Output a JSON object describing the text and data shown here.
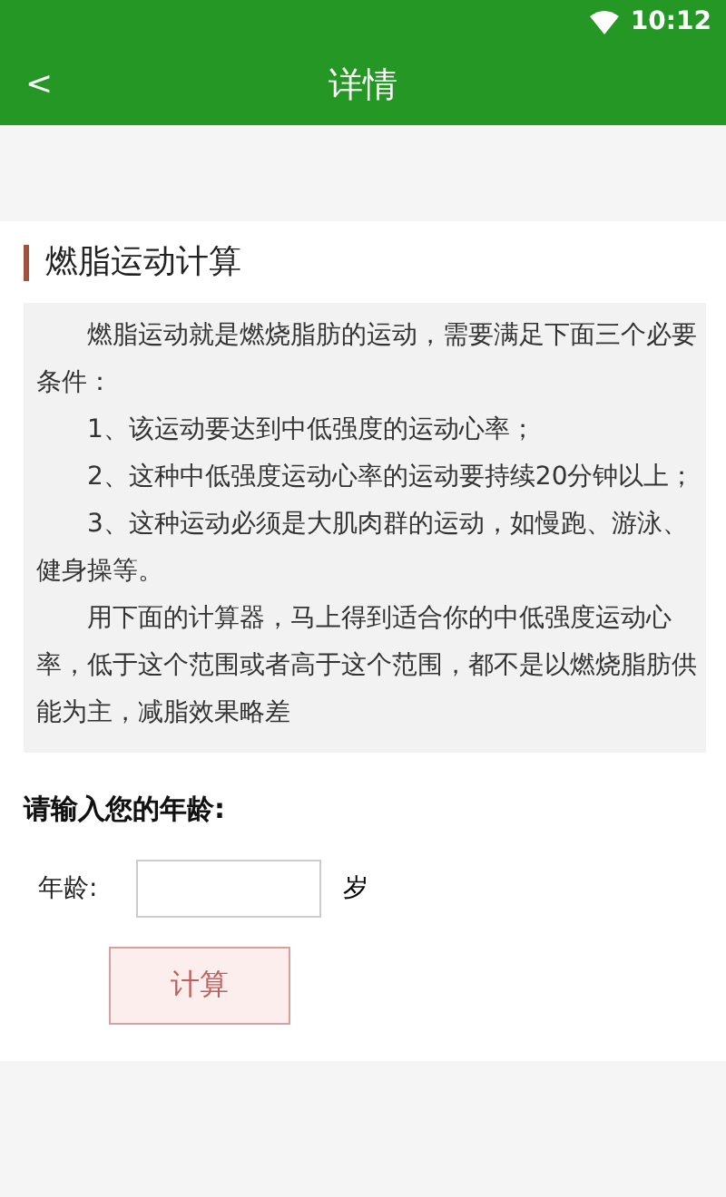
{
  "status_bar": {
    "time": "10:12"
  },
  "app_bar": {
    "back": "<",
    "title": "详情"
  },
  "section": {
    "title": "燃脂运动计算",
    "paragraphs": [
      "燃脂运动就是燃烧脂肪的运动，需要满足下面三个必要条件：",
      "1、该运动要达到中低强度的运动心率；",
      "2、这种中低强度运动心率的运动要持续20分钟以上；",
      "3、这种运动必须是大肌肉群的运动，如慢跑、游泳、健身操等。",
      "用下面的计算器，马上得到适合你的中低强度运动心率，低于这个范围或者高于这个范围，都不是以燃烧脂肪供能为主，减脂效果略差"
    ]
  },
  "form": {
    "prompt": "请输入您的年龄:",
    "age_label": "年龄:",
    "unit": "岁",
    "button": "计算"
  }
}
